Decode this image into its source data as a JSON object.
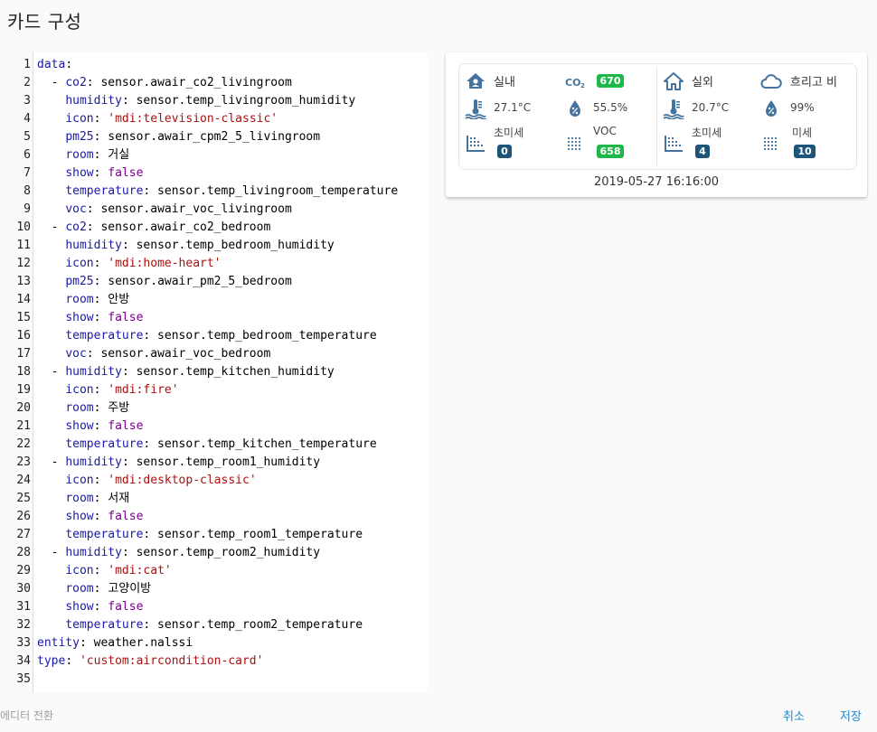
{
  "dialog": {
    "title": "카드 구성"
  },
  "editor": {
    "lines": [
      {
        "n": "1",
        "parts": [
          {
            "c": "k",
            "t": "data"
          },
          {
            "c": "",
            "t": ":"
          }
        ]
      },
      {
        "n": "2",
        "parts": [
          {
            "c": "",
            "t": "  - "
          },
          {
            "c": "k",
            "t": "co2"
          },
          {
            "c": "",
            "t": ": sensor.awair_co2_livingroom"
          }
        ]
      },
      {
        "n": "3",
        "parts": [
          {
            "c": "",
            "t": "    "
          },
          {
            "c": "k",
            "t": "humidity"
          },
          {
            "c": "",
            "t": ": sensor.temp_livingroom_humidity"
          }
        ]
      },
      {
        "n": "4",
        "parts": [
          {
            "c": "",
            "t": "    "
          },
          {
            "c": "k",
            "t": "icon"
          },
          {
            "c": "",
            "t": ": "
          },
          {
            "c": "s",
            "t": "'mdi:television-classic'"
          }
        ]
      },
      {
        "n": "5",
        "parts": [
          {
            "c": "",
            "t": "    "
          },
          {
            "c": "k",
            "t": "pm25"
          },
          {
            "c": "",
            "t": ": sensor.awair_cpm2_5_livingroom"
          }
        ]
      },
      {
        "n": "6",
        "parts": [
          {
            "c": "",
            "t": "    "
          },
          {
            "c": "k",
            "t": "room"
          },
          {
            "c": "",
            "t": ": 거실"
          }
        ]
      },
      {
        "n": "7",
        "parts": [
          {
            "c": "",
            "t": "    "
          },
          {
            "c": "k",
            "t": "show"
          },
          {
            "c": "",
            "t": ": "
          },
          {
            "c": "a",
            "t": "false"
          }
        ]
      },
      {
        "n": "8",
        "parts": [
          {
            "c": "",
            "t": "    "
          },
          {
            "c": "k",
            "t": "temperature"
          },
          {
            "c": "",
            "t": ": sensor.temp_livingroom_temperature"
          }
        ]
      },
      {
        "n": "9",
        "parts": [
          {
            "c": "",
            "t": "    "
          },
          {
            "c": "k",
            "t": "voc"
          },
          {
            "c": "",
            "t": ": sensor.awair_voc_livingroom"
          }
        ]
      },
      {
        "n": "10",
        "parts": [
          {
            "c": "",
            "t": "  - "
          },
          {
            "c": "k",
            "t": "co2"
          },
          {
            "c": "",
            "t": ": sensor.awair_co2_bedroom"
          }
        ]
      },
      {
        "n": "11",
        "parts": [
          {
            "c": "",
            "t": "    "
          },
          {
            "c": "k",
            "t": "humidity"
          },
          {
            "c": "",
            "t": ": sensor.temp_bedroom_humidity"
          }
        ]
      },
      {
        "n": "12",
        "parts": [
          {
            "c": "",
            "t": "    "
          },
          {
            "c": "k",
            "t": "icon"
          },
          {
            "c": "",
            "t": ": "
          },
          {
            "c": "s",
            "t": "'mdi:home-heart'"
          }
        ]
      },
      {
        "n": "13",
        "parts": [
          {
            "c": "",
            "t": "    "
          },
          {
            "c": "k",
            "t": "pm25"
          },
          {
            "c": "",
            "t": ": sensor.awair_pm2_5_bedroom"
          }
        ]
      },
      {
        "n": "14",
        "parts": [
          {
            "c": "",
            "t": "    "
          },
          {
            "c": "k",
            "t": "room"
          },
          {
            "c": "",
            "t": ": 안방"
          }
        ]
      },
      {
        "n": "15",
        "parts": [
          {
            "c": "",
            "t": "    "
          },
          {
            "c": "k",
            "t": "show"
          },
          {
            "c": "",
            "t": ": "
          },
          {
            "c": "a",
            "t": "false"
          }
        ]
      },
      {
        "n": "16",
        "parts": [
          {
            "c": "",
            "t": "    "
          },
          {
            "c": "k",
            "t": "temperature"
          },
          {
            "c": "",
            "t": ": sensor.temp_bedroom_temperature"
          }
        ]
      },
      {
        "n": "17",
        "parts": [
          {
            "c": "",
            "t": "    "
          },
          {
            "c": "k",
            "t": "voc"
          },
          {
            "c": "",
            "t": ": sensor.awair_voc_bedroom"
          }
        ]
      },
      {
        "n": "18",
        "parts": [
          {
            "c": "",
            "t": "  - "
          },
          {
            "c": "k",
            "t": "humidity"
          },
          {
            "c": "",
            "t": ": sensor.temp_kitchen_humidity"
          }
        ]
      },
      {
        "n": "19",
        "parts": [
          {
            "c": "",
            "t": "    "
          },
          {
            "c": "k",
            "t": "icon"
          },
          {
            "c": "",
            "t": ": "
          },
          {
            "c": "s",
            "t": "'mdi:fire'"
          }
        ]
      },
      {
        "n": "20",
        "parts": [
          {
            "c": "",
            "t": "    "
          },
          {
            "c": "k",
            "t": "room"
          },
          {
            "c": "",
            "t": ": 주방"
          }
        ]
      },
      {
        "n": "21",
        "parts": [
          {
            "c": "",
            "t": "    "
          },
          {
            "c": "k",
            "t": "show"
          },
          {
            "c": "",
            "t": ": "
          },
          {
            "c": "a",
            "t": "false"
          }
        ]
      },
      {
        "n": "22",
        "parts": [
          {
            "c": "",
            "t": "    "
          },
          {
            "c": "k",
            "t": "temperature"
          },
          {
            "c": "",
            "t": ": sensor.temp_kitchen_temperature"
          }
        ]
      },
      {
        "n": "23",
        "parts": [
          {
            "c": "",
            "t": "  - "
          },
          {
            "c": "k",
            "t": "humidity"
          },
          {
            "c": "",
            "t": ": sensor.temp_room1_humidity"
          }
        ]
      },
      {
        "n": "24",
        "parts": [
          {
            "c": "",
            "t": "    "
          },
          {
            "c": "k",
            "t": "icon"
          },
          {
            "c": "",
            "t": ": "
          },
          {
            "c": "s",
            "t": "'mdi:desktop-classic'"
          }
        ]
      },
      {
        "n": "25",
        "parts": [
          {
            "c": "",
            "t": "    "
          },
          {
            "c": "k",
            "t": "room"
          },
          {
            "c": "",
            "t": ": 서재"
          }
        ]
      },
      {
        "n": "26",
        "parts": [
          {
            "c": "",
            "t": "    "
          },
          {
            "c": "k",
            "t": "show"
          },
          {
            "c": "",
            "t": ": "
          },
          {
            "c": "a",
            "t": "false"
          }
        ]
      },
      {
        "n": "27",
        "parts": [
          {
            "c": "",
            "t": "    "
          },
          {
            "c": "k",
            "t": "temperature"
          },
          {
            "c": "",
            "t": ": sensor.temp_room1_temperature"
          }
        ]
      },
      {
        "n": "28",
        "parts": [
          {
            "c": "",
            "t": "  - "
          },
          {
            "c": "k",
            "t": "humidity"
          },
          {
            "c": "",
            "t": ": sensor.temp_room2_humidity"
          }
        ]
      },
      {
        "n": "29",
        "parts": [
          {
            "c": "",
            "t": "    "
          },
          {
            "c": "k",
            "t": "icon"
          },
          {
            "c": "",
            "t": ": "
          },
          {
            "c": "s",
            "t": "'mdi:cat'"
          }
        ]
      },
      {
        "n": "30",
        "parts": [
          {
            "c": "",
            "t": "    "
          },
          {
            "c": "k",
            "t": "room"
          },
          {
            "c": "",
            "t": ": 고양이방"
          }
        ]
      },
      {
        "n": "31",
        "parts": [
          {
            "c": "",
            "t": "    "
          },
          {
            "c": "k",
            "t": "show"
          },
          {
            "c": "",
            "t": ": "
          },
          {
            "c": "a",
            "t": "false"
          }
        ]
      },
      {
        "n": "32",
        "parts": [
          {
            "c": "",
            "t": "    "
          },
          {
            "c": "k",
            "t": "temperature"
          },
          {
            "c": "",
            "t": ": sensor.temp_room2_temperature"
          }
        ]
      },
      {
        "n": "33",
        "parts": [
          {
            "c": "k",
            "t": "entity"
          },
          {
            "c": "",
            "t": ": weather.nalssi"
          }
        ]
      },
      {
        "n": "34",
        "parts": [
          {
            "c": "k",
            "t": "type"
          },
          {
            "c": "",
            "t": ": "
          },
          {
            "c": "s",
            "t": "'custom:aircondition-card'"
          }
        ]
      },
      {
        "n": "35",
        "parts": []
      }
    ]
  },
  "card": {
    "indoor": {
      "label": "실내",
      "temperature": "27.1°C",
      "humidity": "55.5%",
      "pm25_label": "초미세",
      "pm25_value": "0",
      "co2_icon_text": "CO₂",
      "co2_value": "670",
      "voc_label": "VOC",
      "voc_value": "658",
      "icons": {
        "room": "home-account-icon",
        "temp": "thermometer-water-icon",
        "humidity": "water-percent-icon",
        "pm25": "dots-grid-icon",
        "voc": "dots-grid-icon"
      }
    },
    "outdoor": {
      "label": "실외",
      "weather": "흐리고 비",
      "temperature": "20.7°C",
      "humidity": "99%",
      "pm25_label": "초미세",
      "pm25_value": "4",
      "pm10_label": "미세",
      "pm10_value": "10",
      "icons": {
        "home": "home-outline-icon",
        "weather": "cloud-outline-icon"
      }
    },
    "timestamp": "2019-05-27 16:16:00",
    "colors": {
      "icon": "#44739e",
      "badge_green": "#1eb84a",
      "badge_blue": "#1b5578"
    }
  },
  "footer": {
    "toggle_editor": "에디터 전환",
    "cancel": "취소",
    "save": "저장"
  }
}
